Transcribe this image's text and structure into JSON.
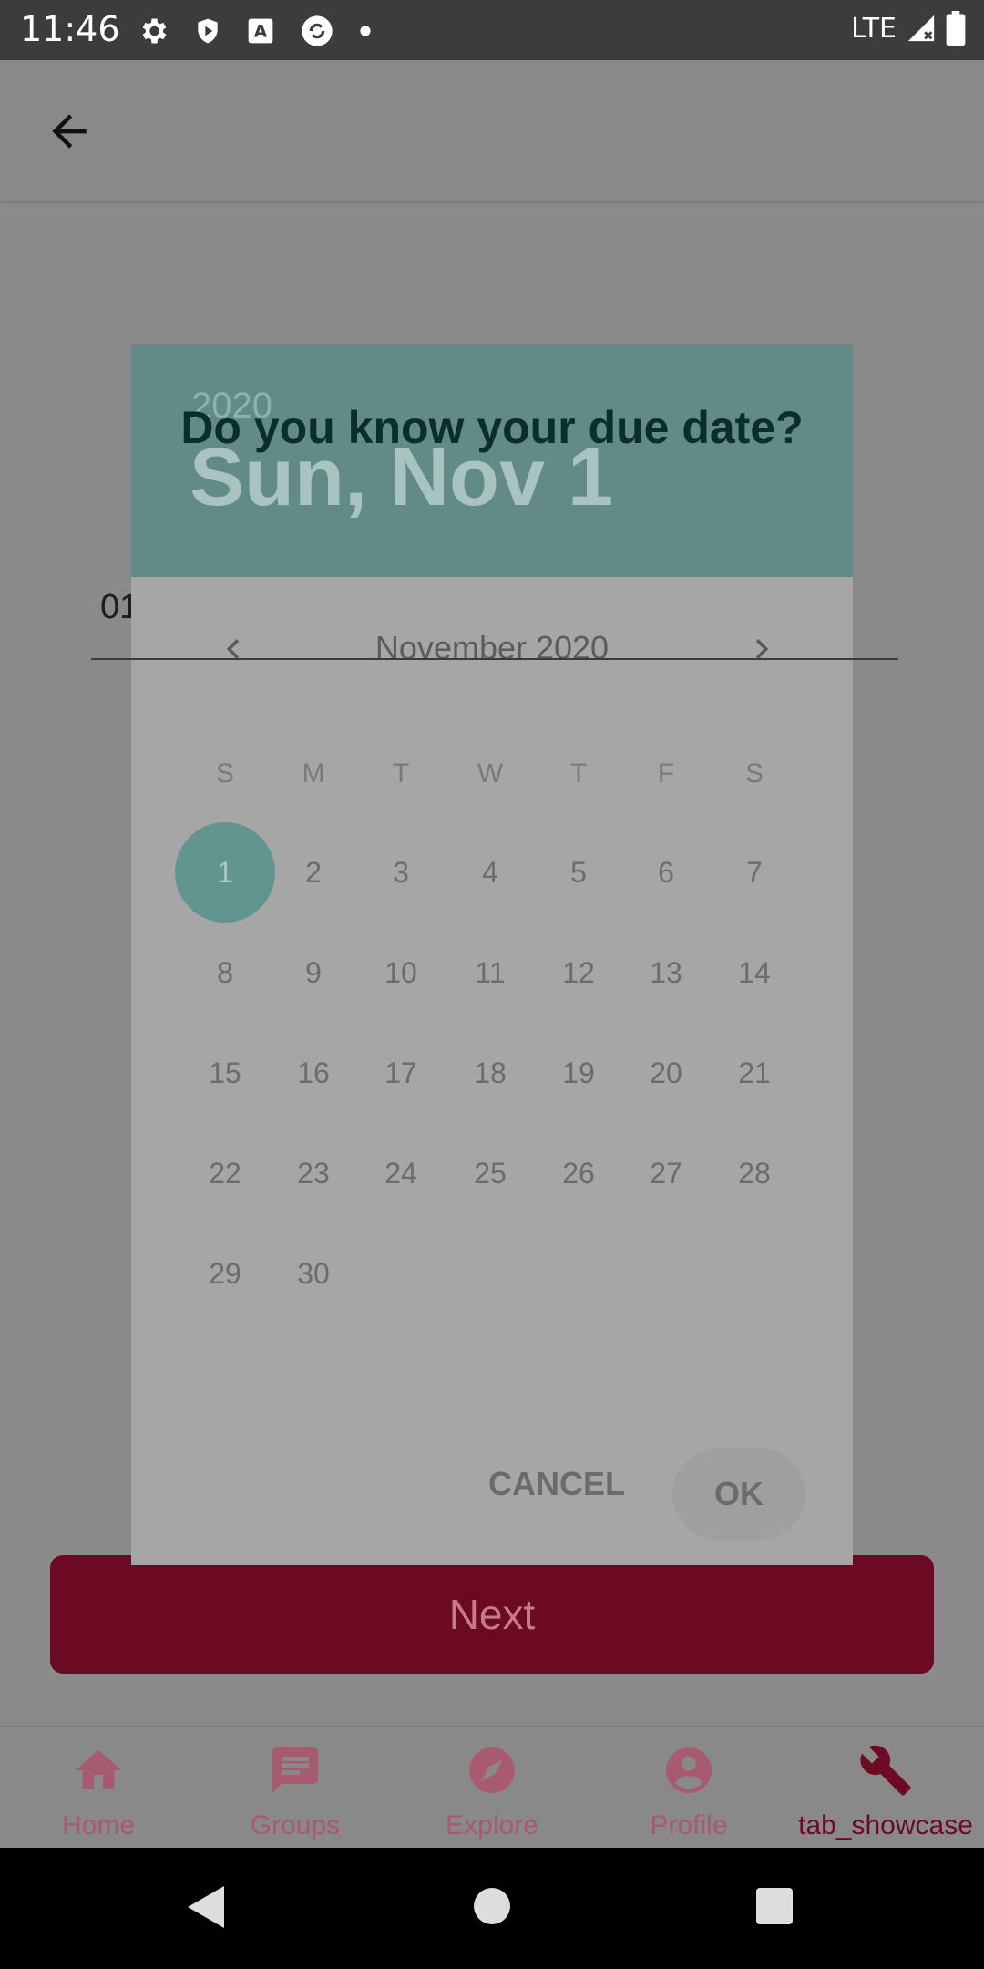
{
  "status_bar": {
    "time": "11:46",
    "network": "LTE"
  },
  "toolbar": {
    "back_icon": "arrow-back-icon"
  },
  "page": {
    "question": "Do you know your due date?",
    "date_field_value": "01/11/2020",
    "next_label": "Next"
  },
  "dialog": {
    "year": "2020",
    "selected_date": "Sun, Nov 1",
    "month_label": "November 2020",
    "weekdays": [
      "S",
      "M",
      "T",
      "W",
      "T",
      "F",
      "S"
    ],
    "days": [
      "1",
      "2",
      "3",
      "4",
      "5",
      "6",
      "7",
      "8",
      "9",
      "10",
      "11",
      "12",
      "13",
      "14",
      "15",
      "16",
      "17",
      "18",
      "19",
      "20",
      "21",
      "22",
      "23",
      "24",
      "25",
      "26",
      "27",
      "28",
      "29",
      "30"
    ],
    "selected_day": "1",
    "cancel_label": "CANCEL",
    "ok_label": "OK",
    "header_color": "#628a86"
  },
  "bottom_nav": [
    {
      "label": "Home",
      "icon": "home-icon"
    },
    {
      "label": "Groups",
      "icon": "chat-icon"
    },
    {
      "label": "Explore",
      "icon": "compass-icon"
    },
    {
      "label": "Profile",
      "icon": "account-icon"
    },
    {
      "label": "tab_showcase",
      "icon": "wrench-icon",
      "active": true
    }
  ],
  "colors": {
    "accent": "#6b0a22",
    "teal": "#62958f"
  }
}
